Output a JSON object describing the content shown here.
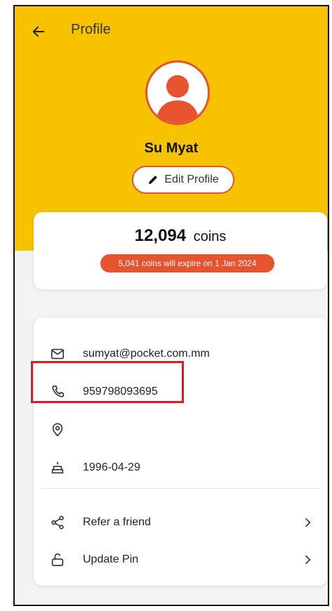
{
  "header": {
    "title": "Profile",
    "back_icon": "arrow-left-icon",
    "background_color": "#f7c300"
  },
  "profile": {
    "name": "Su Myat",
    "avatar_icon": "user-avatar-icon",
    "edit_label": "Edit Profile",
    "accent_color": "#e8532f"
  },
  "coins": {
    "value": "12,094",
    "unit": "coins",
    "expiry_notice": "5,041 coins will expire on 1 Jan 2024"
  },
  "info": {
    "email": "sumyat@pocket.com.mm",
    "phone": "959798093695",
    "location": "",
    "birthday": "1996-04-29"
  },
  "actions": {
    "refer_label": "Refer a friend",
    "update_pin_label": "Update Pin"
  },
  "annotation": {
    "highlight_color": "#e01b24"
  }
}
